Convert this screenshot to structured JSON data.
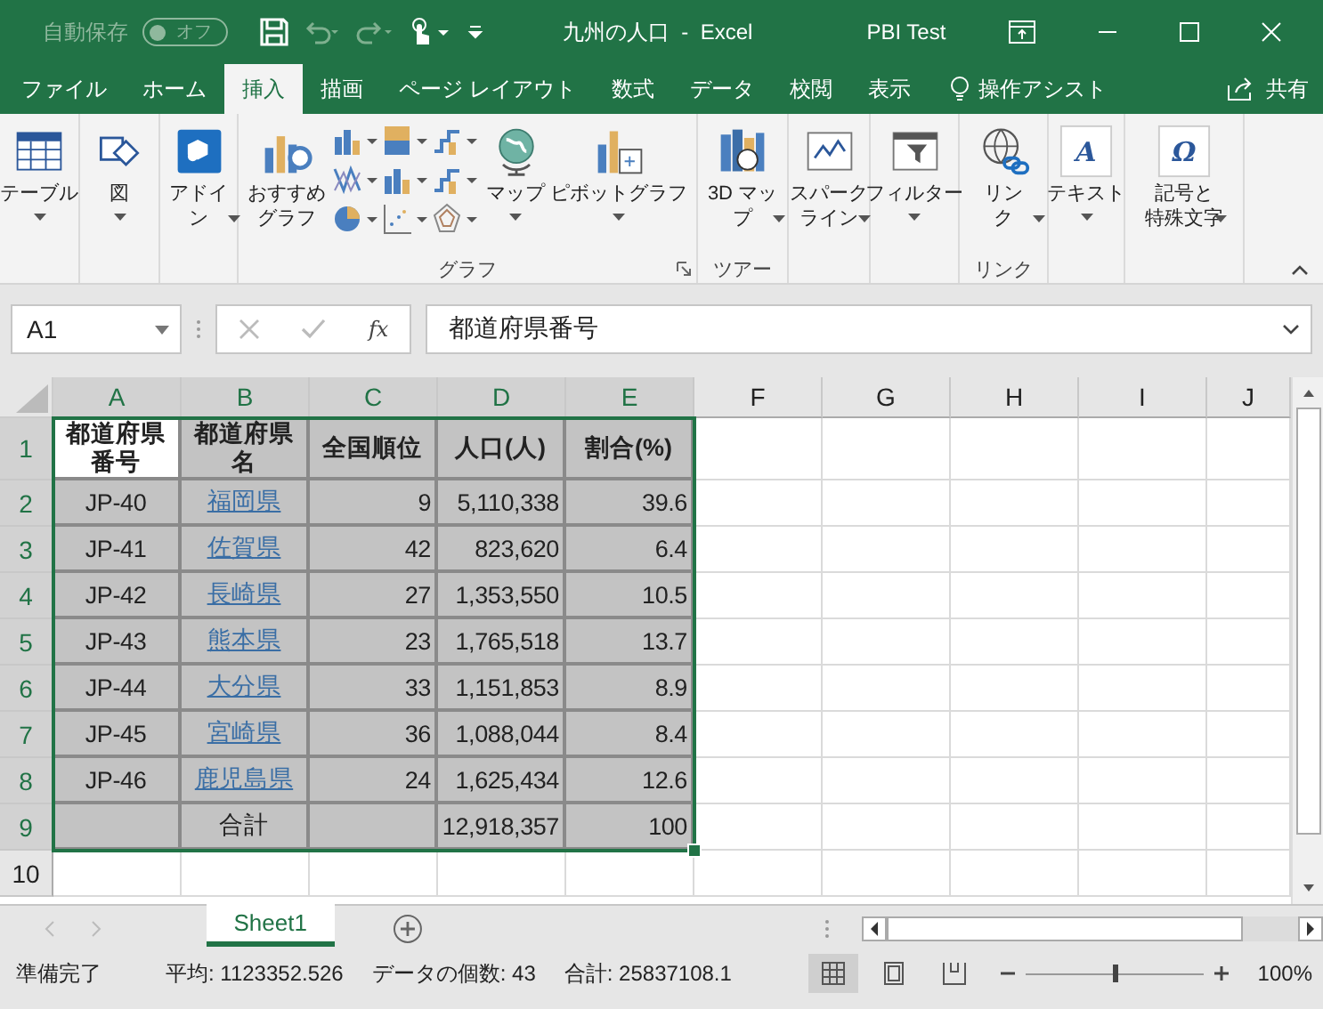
{
  "title_bar": {
    "autosave_label": "自動保存",
    "autosave_toggle": {
      "text": "オフ",
      "on": false
    },
    "title": "九州の人口  -  Excel",
    "user": "PBI Test"
  },
  "tabs": [
    {
      "label": "ファイル",
      "selected": false
    },
    {
      "label": "ホーム",
      "selected": false
    },
    {
      "label": "挿入",
      "selected": true
    },
    {
      "label": "描画",
      "selected": false
    },
    {
      "label": "ページ レイアウト",
      "selected": false
    },
    {
      "label": "数式",
      "selected": false
    },
    {
      "label": "データ",
      "selected": false
    },
    {
      "label": "校閲",
      "selected": false
    },
    {
      "label": "表示",
      "selected": false
    }
  ],
  "tell_me": "操作アシスト",
  "share": "共有",
  "ribbon": {
    "groups": [
      {
        "items": [
          {
            "kind": "large",
            "label": "テーブル",
            "dropdown": true
          }
        ]
      },
      {
        "items": [
          {
            "kind": "large",
            "label": "図",
            "dropdown": true
          }
        ]
      },
      {
        "items": [
          {
            "kind": "large",
            "label": "アドイン",
            "dropdown": true
          }
        ]
      },
      {
        "label": "グラフ",
        "launcher": true,
        "items": [
          {
            "kind": "large",
            "label": "おすすめグラフ",
            "dropdown": false
          },
          {
            "kind": "small-grid"
          },
          {
            "kind": "large",
            "label": "マップ",
            "dropdown": true
          },
          {
            "kind": "large",
            "label": "ピボットグラフ",
            "dropdown": true
          }
        ]
      },
      {
        "label": "ツアー",
        "items": [
          {
            "kind": "large",
            "label": "3D マップ",
            "dropdown": true
          }
        ]
      },
      {
        "items": [
          {
            "kind": "large",
            "label": "スパークライン",
            "dropdown": true
          }
        ]
      },
      {
        "items": [
          {
            "kind": "large",
            "label": "フィルター",
            "dropdown": true
          }
        ]
      },
      {
        "label": "リンク",
        "items": [
          {
            "kind": "large",
            "label": "リンク",
            "dropdown": true
          }
        ]
      },
      {
        "items": [
          {
            "kind": "large",
            "glyph": "A",
            "label": "テキスト",
            "dropdown": true
          }
        ]
      },
      {
        "items": [
          {
            "kind": "large",
            "glyph": "Ω",
            "label": "記号と特殊文字",
            "dropdown": true
          }
        ]
      }
    ]
  },
  "formula_bar": {
    "name_box": "A1",
    "fx": "fx",
    "formula": "都道府県番号"
  },
  "sheet": {
    "columns": [
      {
        "label": "A",
        "selected": true
      },
      {
        "label": "B",
        "selected": true
      },
      {
        "label": "C",
        "selected": true
      },
      {
        "label": "D",
        "selected": true
      },
      {
        "label": "E",
        "selected": true
      },
      {
        "label": "F",
        "selected": false
      },
      {
        "label": "G",
        "selected": false
      },
      {
        "label": "H",
        "selected": false
      },
      {
        "label": "I",
        "selected": false
      },
      {
        "label": "J",
        "selected": false
      }
    ],
    "rows": [
      {
        "label": "1",
        "selected": true,
        "cells": [
          {
            "text": "都道府県番号",
            "kind": "header",
            "selected": true,
            "active": true
          },
          {
            "text": "都道府県名",
            "kind": "header",
            "selected": true,
            "active": false
          },
          {
            "text": "全国順位",
            "kind": "header",
            "selected": true,
            "active": false
          },
          {
            "text": "人口(人)",
            "kind": "header",
            "selected": true,
            "active": false
          },
          {
            "text": "割合(%)",
            "kind": "header",
            "selected": true,
            "active": false
          }
        ]
      },
      {
        "label": "2",
        "selected": true,
        "cells": [
          {
            "text": "JP-40",
            "kind": "text",
            "selected": true,
            "active": false
          },
          {
            "text": "福岡県",
            "kind": "link",
            "selected": true,
            "active": false
          },
          {
            "text": "9",
            "kind": "number",
            "selected": true,
            "active": false
          },
          {
            "text": "5,110,338",
            "kind": "number",
            "selected": true,
            "active": false
          },
          {
            "text": "39.6",
            "kind": "number",
            "selected": true,
            "active": false
          }
        ]
      },
      {
        "label": "3",
        "selected": true,
        "cells": [
          {
            "text": "JP-41",
            "kind": "text",
            "selected": true,
            "active": false
          },
          {
            "text": "佐賀県",
            "kind": "link",
            "selected": true,
            "active": false
          },
          {
            "text": "42",
            "kind": "number",
            "selected": true,
            "active": false
          },
          {
            "text": "823,620",
            "kind": "number",
            "selected": true,
            "active": false
          },
          {
            "text": "6.4",
            "kind": "number",
            "selected": true,
            "active": false
          }
        ]
      },
      {
        "label": "4",
        "selected": true,
        "cells": [
          {
            "text": "JP-42",
            "kind": "text",
            "selected": true,
            "active": false
          },
          {
            "text": "長崎県",
            "kind": "link",
            "selected": true,
            "active": false
          },
          {
            "text": "27",
            "kind": "number",
            "selected": true,
            "active": false
          },
          {
            "text": "1,353,550",
            "kind": "number",
            "selected": true,
            "active": false
          },
          {
            "text": "10.5",
            "kind": "number",
            "selected": true,
            "active": false
          }
        ]
      },
      {
        "label": "5",
        "selected": true,
        "cells": [
          {
            "text": "JP-43",
            "kind": "text",
            "selected": true,
            "active": false
          },
          {
            "text": "熊本県",
            "kind": "link",
            "selected": true,
            "active": false
          },
          {
            "text": "23",
            "kind": "number",
            "selected": true,
            "active": false
          },
          {
            "text": "1,765,518",
            "kind": "number",
            "selected": true,
            "active": false
          },
          {
            "text": "13.7",
            "kind": "number",
            "selected": true,
            "active": false
          }
        ]
      },
      {
        "label": "6",
        "selected": true,
        "cells": [
          {
            "text": "JP-44",
            "kind": "text",
            "selected": true,
            "active": false
          },
          {
            "text": "大分県",
            "kind": "link",
            "selected": true,
            "active": false
          },
          {
            "text": "33",
            "kind": "number",
            "selected": true,
            "active": false
          },
          {
            "text": "1,151,853",
            "kind": "number",
            "selected": true,
            "active": false
          },
          {
            "text": "8.9",
            "kind": "number",
            "selected": true,
            "active": false
          }
        ]
      },
      {
        "label": "7",
        "selected": true,
        "cells": [
          {
            "text": "JP-45",
            "kind": "text",
            "selected": true,
            "active": false
          },
          {
            "text": "宮崎県",
            "kind": "link",
            "selected": true,
            "active": false
          },
          {
            "text": "36",
            "kind": "number",
            "selected": true,
            "active": false
          },
          {
            "text": "1,088,044",
            "kind": "number",
            "selected": true,
            "active": false
          },
          {
            "text": "8.4",
            "kind": "number",
            "selected": true,
            "active": false
          }
        ]
      },
      {
        "label": "8",
        "selected": true,
        "cells": [
          {
            "text": "JP-46",
            "kind": "text",
            "selected": true,
            "active": false
          },
          {
            "text": "鹿児島県",
            "kind": "link",
            "selected": true,
            "active": false
          },
          {
            "text": "24",
            "kind": "number",
            "selected": true,
            "active": false
          },
          {
            "text": "1,625,434",
            "kind": "number",
            "selected": true,
            "active": false
          },
          {
            "text": "12.6",
            "kind": "number",
            "selected": true,
            "active": false
          }
        ]
      },
      {
        "label": "9",
        "selected": true,
        "cells": [
          {
            "selected": true,
            "active": false
          },
          {
            "text": "合計",
            "kind": "text",
            "selected": true,
            "active": false
          },
          {
            "selected": true,
            "active": false
          },
          {
            "text": "12,918,357",
            "kind": "number",
            "selected": true,
            "active": false
          },
          {
            "text": "100",
            "kind": "number",
            "selected": true,
            "active": false
          }
        ]
      },
      {
        "label": "10",
        "selected": false,
        "cells": []
      }
    ]
  },
  "sheet_tabs": [
    {
      "label": "Sheet1",
      "selected": true
    }
  ],
  "status_bar": {
    "mode": "準備完了",
    "stats": [
      "平均: 1123352.526",
      "データの個数: 43",
      "合計: 25837108.1"
    ],
    "views": [
      {
        "kind": "normal",
        "selected": true
      },
      {
        "kind": "page-layout",
        "selected": false
      },
      {
        "kind": "page-break",
        "selected": false
      }
    ],
    "zoom": {
      "level": 0.5,
      "text": "100%"
    }
  }
}
